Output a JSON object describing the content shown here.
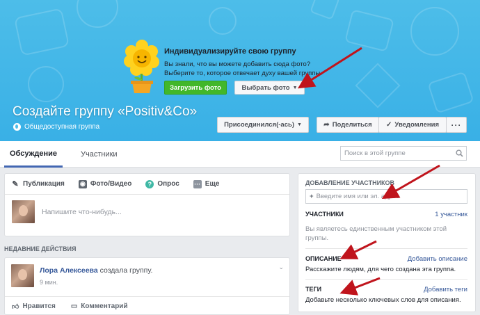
{
  "cover": {
    "title": "Индивидуализируйте свою группу",
    "text": "Вы знали, что вы можете добавить сюда фото? Выберите то, которое отвечает духу вашей группы.",
    "upload_label": "Загрузить фото",
    "choose_label": "Выбрать фото"
  },
  "group": {
    "name": "Создайте группу «Positiv&Co»",
    "privacy": "Общедоступная группа",
    "join_label": "Присоединился(-ась)",
    "share_label": "Поделиться",
    "notify_label": "Уведомления",
    "more_label": "···"
  },
  "tabs": [
    {
      "label": "Обсуждение"
    },
    {
      "label": "Участники"
    }
  ],
  "search": {
    "placeholder": "Поиск в этой группе"
  },
  "composer": {
    "tabs": [
      {
        "label": "Публикация"
      },
      {
        "label": "Фото/Видео"
      },
      {
        "label": "Опрос"
      },
      {
        "label": "Еще"
      }
    ],
    "placeholder": "Напишите что-нибудь..."
  },
  "recent": {
    "label": "НЕДАВНИЕ ДЕЙСТВИЯ"
  },
  "post": {
    "author": "Лора Алексеева",
    "action": "создала группу.",
    "time": "9 мин.",
    "like_label": "Нравится",
    "comment_label": "Комментарий"
  },
  "sidebar": {
    "add_header": "ДОБАВЛЕНИЕ УЧАСТНИКОВ",
    "add_placeholder": "Введите имя или эл. адрес",
    "members_header": "УЧАСТНИКИ",
    "members_count": "1 участник",
    "members_text": "Вы являетесь единственным участником этой группы.",
    "desc_header": "ОПИСАНИЕ",
    "desc_link": "Добавить описание",
    "desc_text": "Расскажите людям, для чего создана эта группа.",
    "tags_header": "ТЕГИ",
    "tags_link": "Добавить теги",
    "tags_text": "Добавьте несколько ключевых слов для описания."
  },
  "colors": {
    "cover": "#3fb5e8",
    "upload_btn": "#42b72a",
    "link": "#365899",
    "tab_accent": "#4267b2",
    "arrow": "#c0141c"
  },
  "icons": [
    "pencil-icon",
    "camera-icon",
    "poll-icon",
    "more-icon",
    "globe-icon",
    "share-icon",
    "check-icon",
    "search-icon",
    "plus-icon",
    "like-icon",
    "comment-icon",
    "chevron-down-icon"
  ]
}
